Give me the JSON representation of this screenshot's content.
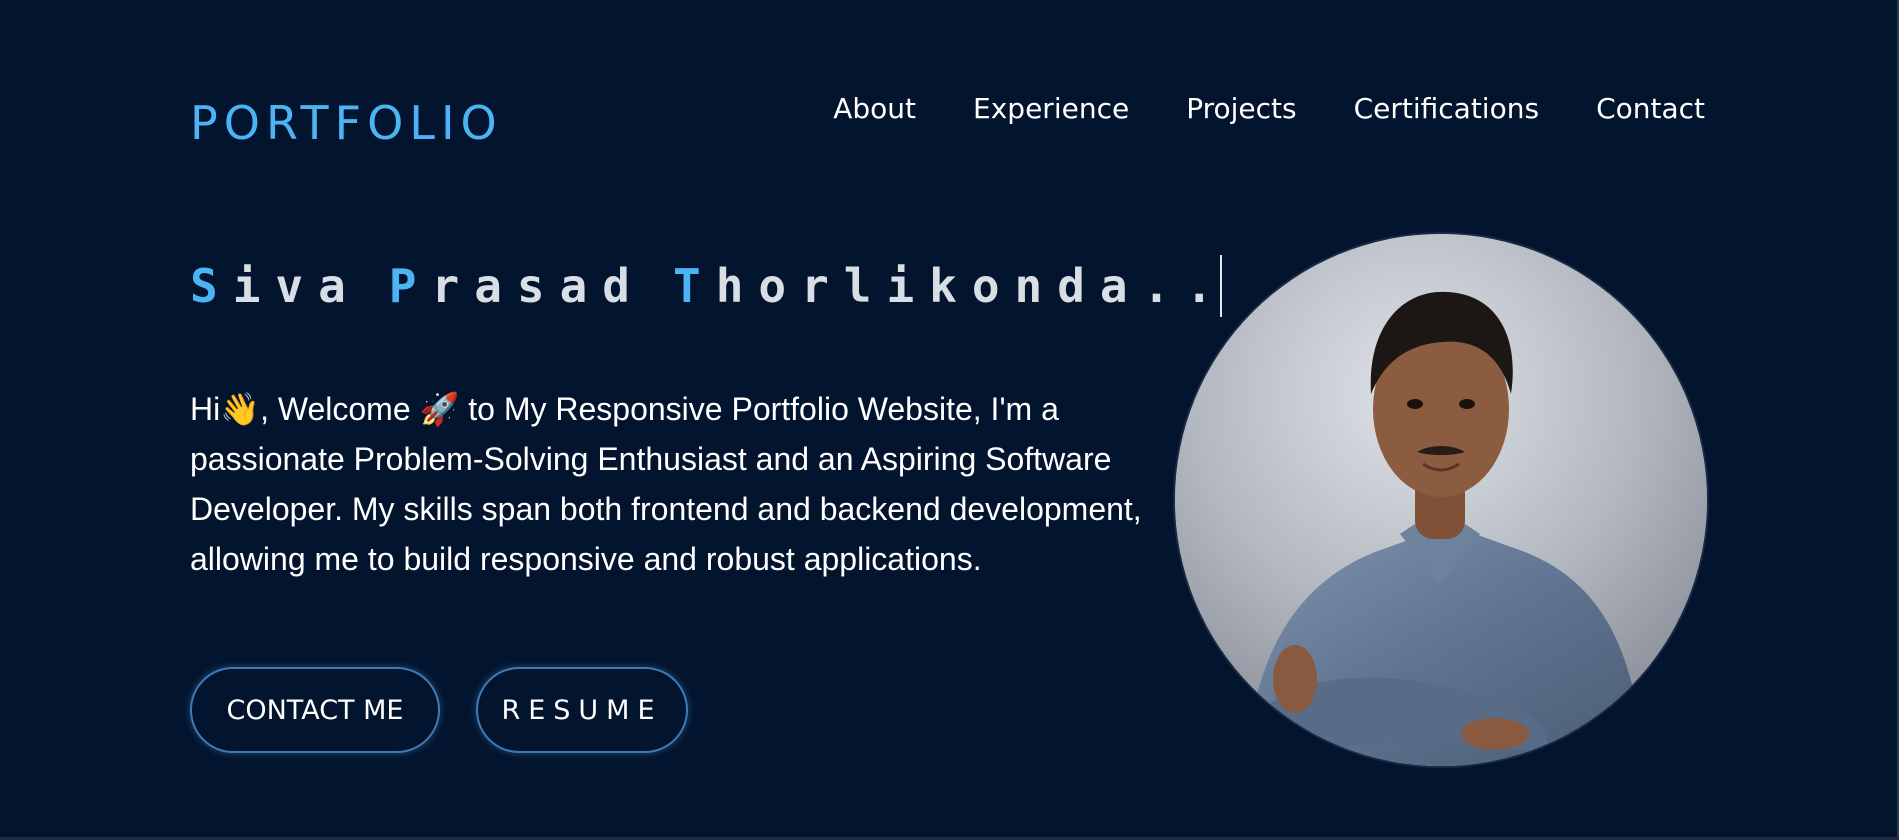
{
  "header": {
    "logo": "PORTFOLIO",
    "nav": [
      {
        "label": "About"
      },
      {
        "label": "Experience"
      },
      {
        "label": "Projects"
      },
      {
        "label": "Certifications"
      },
      {
        "label": "Contact"
      }
    ]
  },
  "hero": {
    "name_parts": [
      {
        "initial": "S",
        "rest": "iva"
      },
      {
        "initial": "P",
        "rest": "rasad"
      },
      {
        "initial": "T",
        "rest": "horlikonda.."
      }
    ],
    "intro": "Hi👋, Welcome 🚀 to My Responsive Portfolio Website, I'm a passionate Problem-Solving Enthusiast and an Aspiring Software Developer. My skills span both frontend and backend development, allowing me to build responsive and robust applications.",
    "buttons": {
      "contact": "CONTACT ME",
      "resume": "RESUME"
    }
  },
  "colors": {
    "background": "#03142e",
    "accent": "#4cb3f5",
    "button_border": "#3f79b6"
  }
}
